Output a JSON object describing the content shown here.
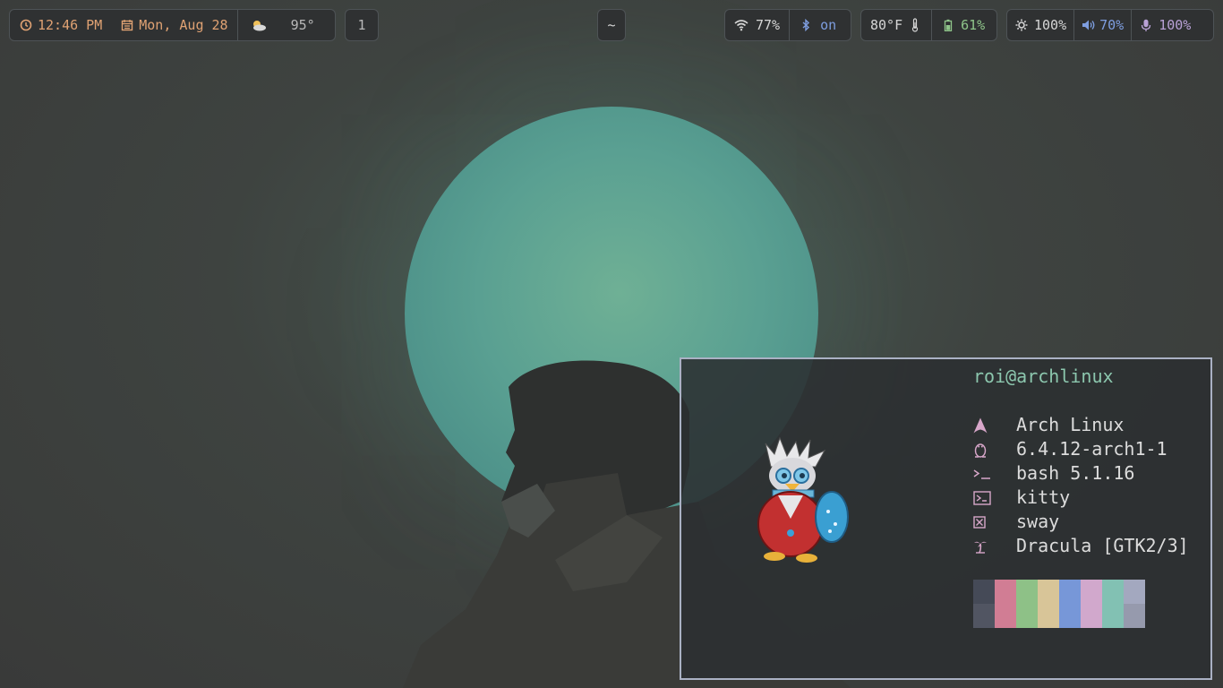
{
  "bar": {
    "clock": {
      "time": "12:46 PM",
      "date": "Mon, Aug 28",
      "icon": "clock-icon",
      "date_icon": "calendar-icon"
    },
    "weather": {
      "value": "95°",
      "icon": "cloud-sun-icon"
    },
    "workspace": {
      "label": "1"
    },
    "title": {
      "label": "~"
    },
    "network": {
      "wifi": "77%",
      "bluetooth": "on"
    },
    "sensors": {
      "temperature": "80°F",
      "battery": "61%"
    },
    "controls": {
      "brightness": "100%",
      "volume": "70%",
      "microphone": "100%"
    }
  },
  "terminal": {
    "userhost": "roi@archlinux",
    "info": [
      {
        "icon": "arch-icon",
        "value": "Arch Linux"
      },
      {
        "icon": "linux-penguin-icon",
        "value": "6.4.12-arch1-1"
      },
      {
        "icon": "shell-prompt-icon",
        "value": "bash 5.1.16"
      },
      {
        "icon": "terminal-icon",
        "value": "kitty"
      },
      {
        "icon": "window-manager-icon",
        "value": "sway"
      },
      {
        "icon": "theme-palm-icon",
        "value": "Dracula [GTK2/3]"
      }
    ],
    "palette": [
      [
        "#454a57",
        "#515562"
      ],
      [
        "#d17d94",
        "#d17d94"
      ],
      [
        "#8ec187",
        "#8ec187"
      ],
      [
        "#d8c598",
        "#d8c598"
      ],
      [
        "#7797d8",
        "#7797d8"
      ],
      [
        "#d1a8cc",
        "#d1a8cc"
      ],
      [
        "#82c1b3",
        "#82c1b3"
      ],
      [
        "#a3a8bf",
        "#969aad"
      ]
    ]
  }
}
